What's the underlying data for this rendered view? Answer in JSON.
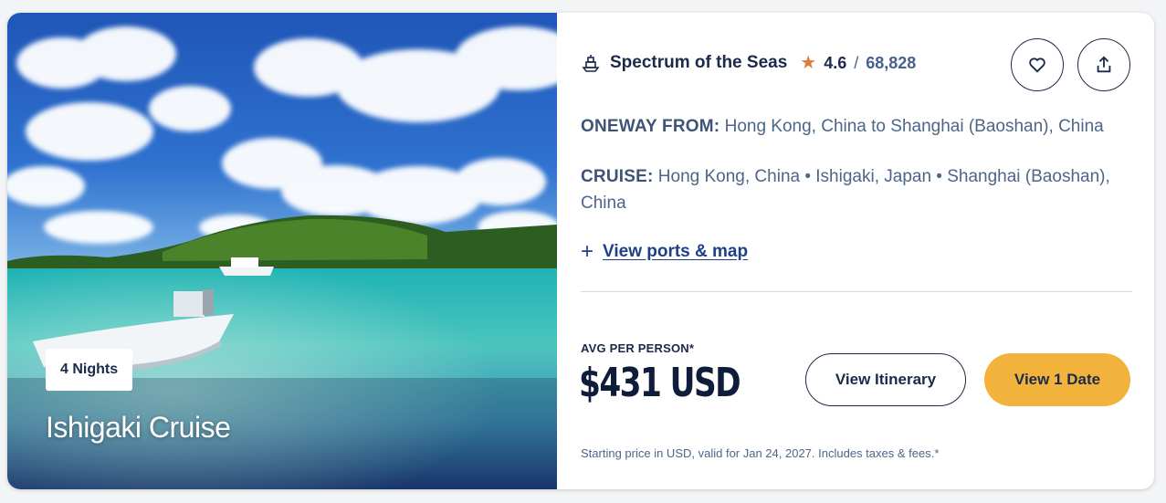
{
  "card": {
    "image_alt": "Tropical island bay with boats",
    "nights_badge": "4 Nights",
    "title": "Ishigaki Cruise"
  },
  "ship": {
    "icon": "ship-icon",
    "name": "Spectrum of the Seas",
    "rating": "4.6",
    "rating_separator": "/",
    "review_count": "68,828",
    "star_color": "#e07a3b"
  },
  "actions": {
    "favorite_icon": "heart-icon",
    "share_icon": "share-icon"
  },
  "route": {
    "oneway_label": "ONEWAY FROM:",
    "oneway_value": "Hong Kong, China to Shanghai (Baoshan), China",
    "cruise_label": "CRUISE:",
    "cruise_value": "Hong Kong, China • Ishigaki, Japan • Shanghai (Baoshan), China"
  },
  "ports_link": {
    "icon": "plus-icon",
    "label": "View ports & map"
  },
  "pricing": {
    "avg_label": "AVG PER PERSON*",
    "price": "$431 USD",
    "disclaimer": "Starting price in USD, valid for Jan 24, 2027. Includes taxes & fees.*"
  },
  "buttons": {
    "itinerary": "View Itinerary",
    "dates": "View 1 Date",
    "dates_color": "#f2b33d"
  }
}
